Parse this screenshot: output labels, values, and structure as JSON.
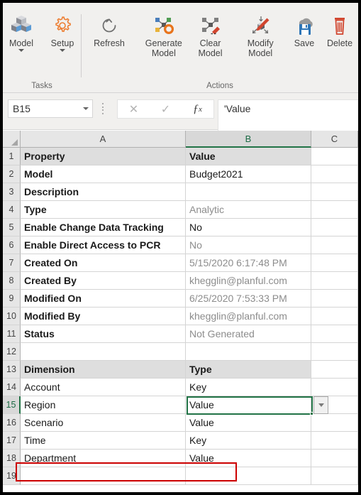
{
  "ribbon": {
    "groups": [
      {
        "name": "tasks",
        "label": "Tasks",
        "buttons": [
          {
            "label": "Model",
            "icon": "cubes-icon",
            "has_caret": true
          },
          {
            "label": "Setup",
            "icon": "gear-icon",
            "has_caret": true
          }
        ]
      },
      {
        "name": "actions",
        "label": "Actions",
        "buttons": [
          {
            "label": "Refresh",
            "icon": "refresh-icon",
            "has_caret": false
          },
          {
            "label": "Generate Model",
            "icon": "generate-model-icon",
            "has_caret": false
          },
          {
            "label": "Clear Model",
            "icon": "clear-model-icon",
            "has_caret": false
          },
          {
            "label": "Modify Model",
            "icon": "modify-model-icon",
            "has_caret": false
          },
          {
            "label": "Save",
            "icon": "save-icon",
            "has_caret": false
          },
          {
            "label": "Delete",
            "icon": "delete-icon",
            "has_caret": false
          }
        ]
      }
    ]
  },
  "formula_bar": {
    "name_box_value": "B15",
    "cancel_icon": "close-icon",
    "enter_icon": "check-icon",
    "function_icon": "fx-icon",
    "formula_value": "'Value"
  },
  "grid": {
    "columns": [
      {
        "label": "A",
        "selected": false
      },
      {
        "label": "B",
        "selected": true
      },
      {
        "label": "C",
        "selected": false
      }
    ],
    "selected_cell": "B15",
    "rows": [
      {
        "num": "1",
        "selected": false,
        "header": true,
        "a": "Property",
        "a_bold": true,
        "b": "Value",
        "b_bold": true,
        "b_gray": false
      },
      {
        "num": "2",
        "selected": false,
        "header": false,
        "a": "Model",
        "a_bold": true,
        "b": "Budget2021",
        "b_bold": false,
        "b_gray": false
      },
      {
        "num": "3",
        "selected": false,
        "header": false,
        "a": "Description",
        "a_bold": true,
        "b": "",
        "b_bold": false,
        "b_gray": false
      },
      {
        "num": "4",
        "selected": false,
        "header": false,
        "a": "Type",
        "a_bold": true,
        "b": "Analytic",
        "b_bold": false,
        "b_gray": true
      },
      {
        "num": "5",
        "selected": false,
        "header": false,
        "a": "Enable Change Data Tracking",
        "a_bold": true,
        "b": "No",
        "b_bold": false,
        "b_gray": false
      },
      {
        "num": "6",
        "selected": false,
        "header": false,
        "a": "Enable Direct Access to PCR",
        "a_bold": true,
        "b": "No",
        "b_bold": false,
        "b_gray": true
      },
      {
        "num": "7",
        "selected": false,
        "header": false,
        "a": "Created On",
        "a_bold": true,
        "b": "5/15/2020 6:17:48 PM",
        "b_bold": false,
        "b_gray": true
      },
      {
        "num": "8",
        "selected": false,
        "header": false,
        "a": "Created By",
        "a_bold": true,
        "b": "khegglin@planful.com",
        "b_bold": false,
        "b_gray": true
      },
      {
        "num": "9",
        "selected": false,
        "header": false,
        "a": "Modified On",
        "a_bold": true,
        "b": "6/25/2020 7:53:33 PM",
        "b_bold": false,
        "b_gray": true
      },
      {
        "num": "10",
        "selected": false,
        "header": false,
        "a": "Modified By",
        "a_bold": true,
        "b": "khegglin@planful.com",
        "b_bold": false,
        "b_gray": true
      },
      {
        "num": "11",
        "selected": false,
        "header": false,
        "a": "Status",
        "a_bold": true,
        "b": "Not Generated",
        "b_bold": false,
        "b_gray": true
      },
      {
        "num": "12",
        "selected": false,
        "header": false,
        "a": "",
        "a_bold": false,
        "b": "",
        "b_bold": false,
        "b_gray": false
      },
      {
        "num": "13",
        "selected": false,
        "header": true,
        "a": "Dimension",
        "a_bold": true,
        "b": "Type",
        "b_bold": true,
        "b_gray": false
      },
      {
        "num": "14",
        "selected": false,
        "header": false,
        "a": "Account",
        "a_bold": false,
        "b": "Key",
        "b_bold": false,
        "b_gray": false
      },
      {
        "num": "15",
        "selected": true,
        "header": false,
        "a": "Region",
        "a_bold": false,
        "b": "Value",
        "b_bold": false,
        "b_gray": false
      },
      {
        "num": "16",
        "selected": false,
        "header": false,
        "a": "Scenario",
        "a_bold": false,
        "b": "Value",
        "b_bold": false,
        "b_gray": false
      },
      {
        "num": "17",
        "selected": false,
        "header": false,
        "a": "Time",
        "a_bold": false,
        "b": "Key",
        "b_bold": false,
        "b_gray": false
      },
      {
        "num": "18",
        "selected": false,
        "header": false,
        "a": "Department",
        "a_bold": false,
        "b": "Value",
        "b_bold": false,
        "b_gray": false
      },
      {
        "num": "19",
        "selected": false,
        "header": false,
        "a": "",
        "a_bold": false,
        "b": "",
        "b_bold": false,
        "b_gray": false
      }
    ],
    "dropdown_icon": "chevron-down-icon",
    "annotation": {
      "target_row": "18",
      "color": "#cc0000"
    }
  },
  "colors": {
    "excel_green": "#217346",
    "annotation_red": "#cc0000",
    "header_fill": "#dedede",
    "ribbon_bg": "#f1f0ee"
  }
}
